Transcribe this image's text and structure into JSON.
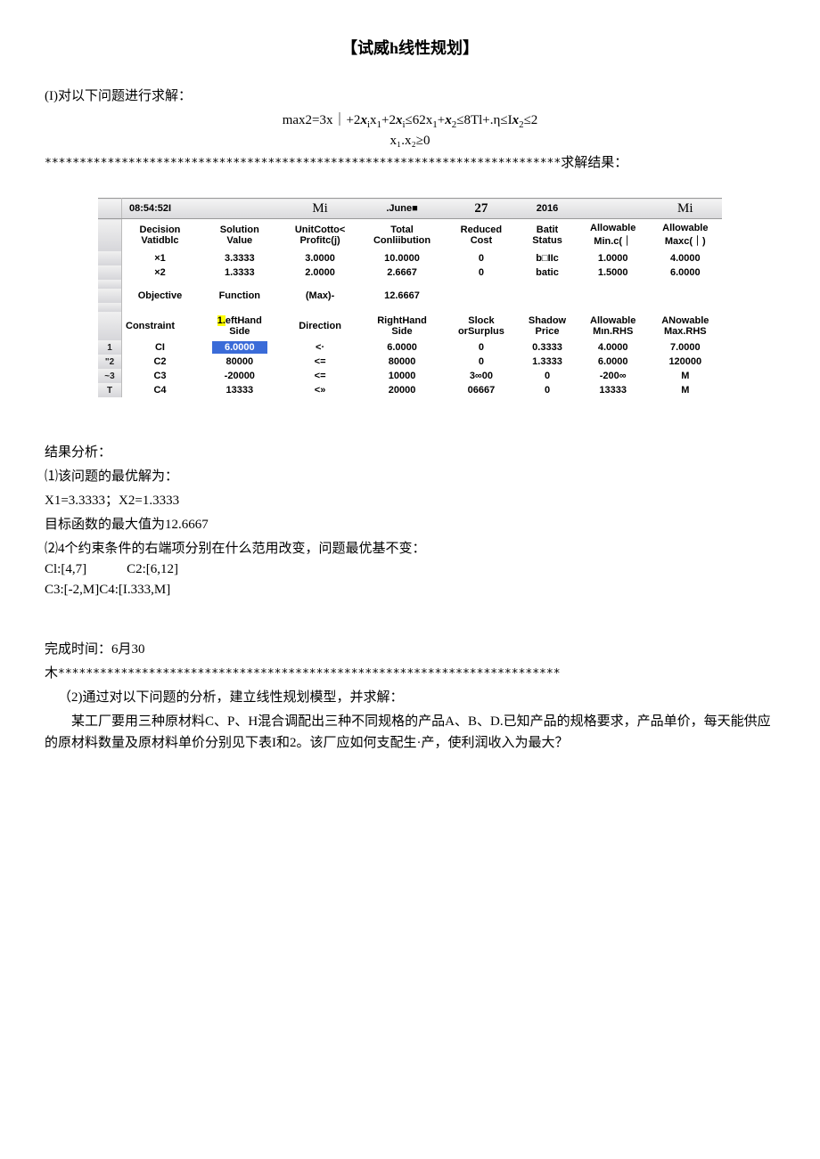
{
  "title": "【试威h线性规划】",
  "problem1_head": "(I)对以下问题进行求解：",
  "formula1": "max2=3x｜+2x<sub>i</sub>x<sub>1</sub>+2x<sub>i</sub>≤62x<sub>1</sub>+x<sub>2</sub>≤8Tl+.η≤Ix<sub>2</sub>≤2",
  "formula2": "x₁.x₂≥0",
  "stars1_suffix": "求解结果：",
  "stars1": "**************************************************************************",
  "solver_header": {
    "time": "08:54:52I",
    "mi1": "Mi",
    "june": ".June■",
    "day": "27",
    "year": "2016",
    "mi2": "Mi"
  },
  "var_cols": [
    "Decision\nVatidblc",
    "Solution\nValue",
    "UnitCotto<\nProfitc(j)",
    "Total\nConliibution",
    "Reduced\nCost",
    "Batit\nStatus",
    "Allowable\nMin.c(｜",
    "Allowable\nMaxc(｜)"
  ],
  "var_rows": [
    {
      "name": "×1",
      "sol": "3.3333",
      "unit": "3.0000",
      "tot": "10.0000",
      "red": "0",
      "stat": "b□IIc",
      "min": "1.0000",
      "max": "4.0000"
    },
    {
      "name": "×2",
      "sol": "1.3333",
      "unit": "2.0000",
      "tot": "2.6667",
      "red": "0",
      "stat": "batic",
      "min": "1.5000",
      "max": "6.0000"
    }
  ],
  "obj_row": {
    "a": "Objective",
    "b": "Function",
    "c": "(Max)-",
    "d": "12.6667"
  },
  "con_cols": {
    "c1": "Constraint",
    "c2": "1.eftHand\nSide",
    "c3": "Direction",
    "c4": "RightHand\nSide",
    "c5": "Slock\norSurplus",
    "c6": "Shadow\nPrice",
    "c7": "Allowable\nMın.RHS",
    "c8": "ANowable\nMax.RHS"
  },
  "con_rows": [
    {
      "idx": "1",
      "name": "CI",
      "lhs": "6.0000",
      "dir": "<·",
      "rhs": "6.0000",
      "slk": "0",
      "shp": "0.3333",
      "min": "4.0000",
      "max": "7.0000",
      "hl": "blue"
    },
    {
      "idx": "\"2",
      "name": "C2",
      "lhs": "80000",
      "dir": "<=",
      "rhs": "80000",
      "slk": "0",
      "shp": "1.3333",
      "min": "6.0000",
      "max": "120000"
    },
    {
      "idx": "~3",
      "name": "C3",
      "lhs": "-20000",
      "dir": "<=",
      "rhs": "10000",
      "slk": "3∞00",
      "shp": "0",
      "min": "-200∞",
      "max": "M"
    },
    {
      "idx": "T",
      "name": "C4",
      "lhs": "13333",
      "dir": "<»",
      "rhs": "20000",
      "slk": "06667",
      "shp": "0",
      "min": "13333",
      "max": "M"
    }
  ],
  "analysis_head": "结果分析：",
  "a1": "⑴该问题的最优解为：",
  "a1a": "X1=3.3333；X2=1.3333",
  "a1b": "目标函数的最大值为12.6667",
  "a2": "⑵4个约束条件的右端项分别在什么范用改变，问题最优基不变：",
  "a2a": "Cl:[4,7]            C2:[6,12]",
  "a2b": "C3:[-2,M]C4:[I.333,M]",
  "done": "完成时间：6月30",
  "stars2_prefix": "木",
  "stars2": "************************************************************************",
  "p2head": "（2)通过对以下问题的分析，建立线性规划模型，并求解：",
  "p2body": "某工厂要用三种原材料C、P、H混合调配出三种不同规格的产品A、B、D.已知产品的规格要求，产品单价，每天能供应的原材料数量及原材料单价分别见下表I和2。该厂应如何支配生·产，使利润收入为最大？"
}
